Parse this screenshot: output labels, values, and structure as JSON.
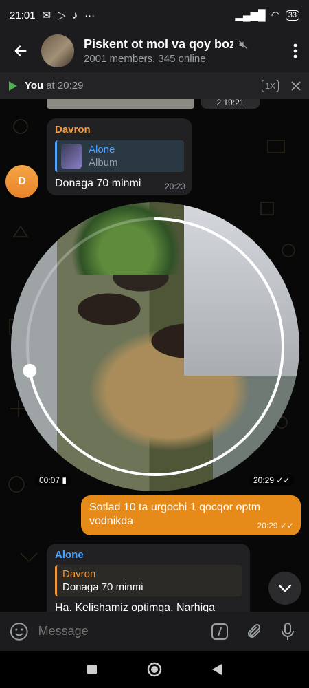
{
  "status_bar": {
    "time": "21:01",
    "dots": "···",
    "battery": "33"
  },
  "header": {
    "title": "Piskent ot mol va qoy bozo",
    "subtitle": "2001 members, 345 online"
  },
  "player": {
    "name": "You",
    "time_text": "at 20:29",
    "speed": "1X"
  },
  "top_snippet": {
    "duration": "2 19:21"
  },
  "message1": {
    "sender": "Davron",
    "reply_name": "Alone",
    "reply_text": "Album",
    "text": "Donaga 70 minmi",
    "time": "20:23",
    "avatar_letter": "D"
  },
  "video_message": {
    "duration": "00:07",
    "time": "20:29",
    "progress": 0.72
  },
  "message2": {
    "text": "Sotlad 10 ta urgochi 1 qocqor optm vodnikda",
    "time": "20:29"
  },
  "message3": {
    "sender": "Alone",
    "reply_name": "Davron",
    "reply_text": "Donaga 70 minmi",
    "text": "Ha. Kelishamiz optimga. Narhiga"
  },
  "input": {
    "placeholder": "Message"
  },
  "colors": {
    "accent_orange": "#e68a1a",
    "accent_blue": "#4aa3ff"
  }
}
